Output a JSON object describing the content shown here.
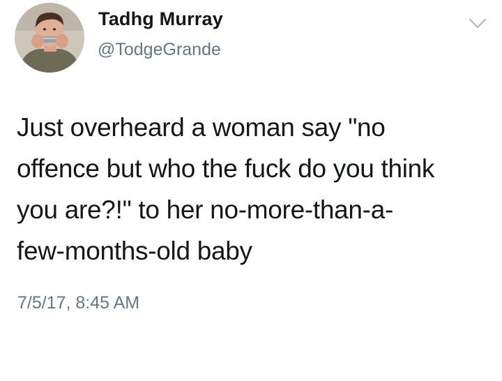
{
  "author": {
    "display_name": "Tadhg Murray",
    "handle": "@TodgeGrande",
    "avatar_icon": "profile-photo-avatar"
  },
  "menu": {
    "icon": "chevron-down-icon"
  },
  "tweet": {
    "lines": [
      "Just overheard a woman say \"no",
      "offence but who the fuck do you think",
      "you are?!\" to her no-more-than-a-",
      "few-months-old baby"
    ],
    "timestamp": "7/5/17, 8:45 AM"
  },
  "colors": {
    "text_primary": "#14171a",
    "text_secondary": "#657786",
    "chevron": "#aab8c2",
    "background": "#ffffff"
  }
}
